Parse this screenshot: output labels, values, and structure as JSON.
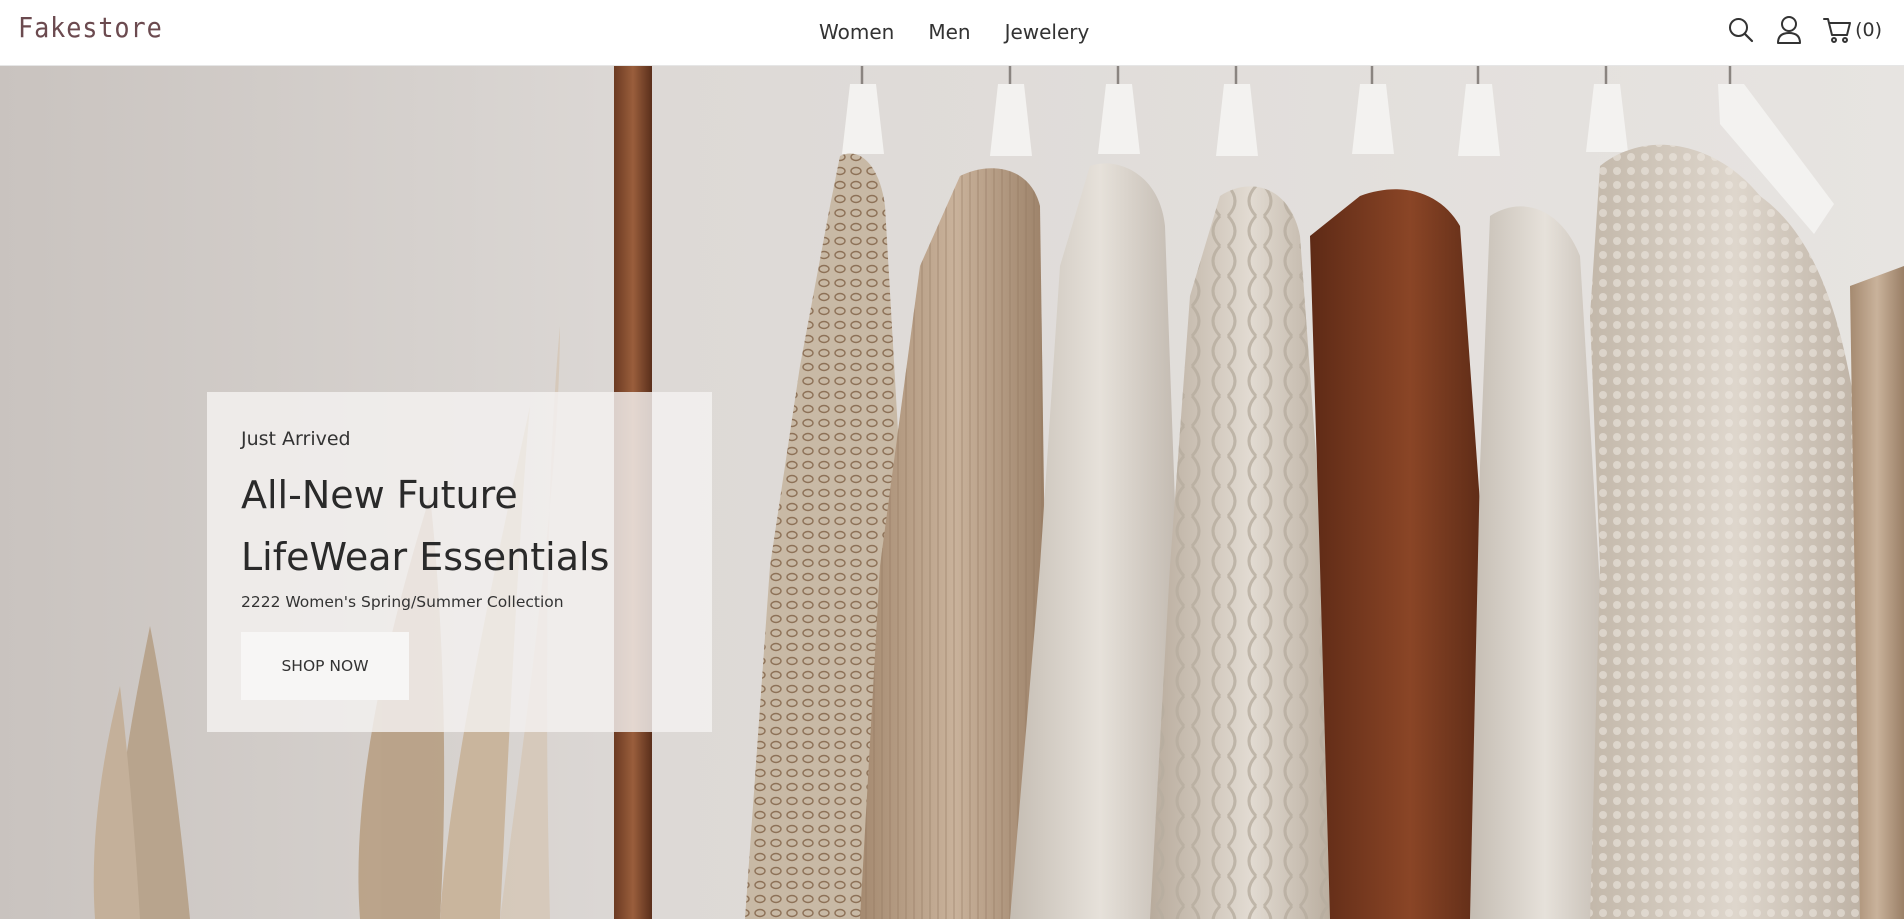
{
  "brand": {
    "logo_text": "Fakestore",
    "logo_color": "#6b4a4f"
  },
  "nav": {
    "links": [
      {
        "label": "Women"
      },
      {
        "label": "Men"
      },
      {
        "label": "Jewelery"
      }
    ],
    "icons": [
      "search-icon",
      "user-icon",
      "cart-icon"
    ],
    "cart_count": "(0)"
  },
  "hero": {
    "background": "clothing-rack-photo",
    "eyebrow": "Just Arrived",
    "headline": "All-New Future LifeWear Essentials",
    "subtitle": "2222 Women's Spring/Summer Collection",
    "cta_label": "SHOP NOW"
  }
}
